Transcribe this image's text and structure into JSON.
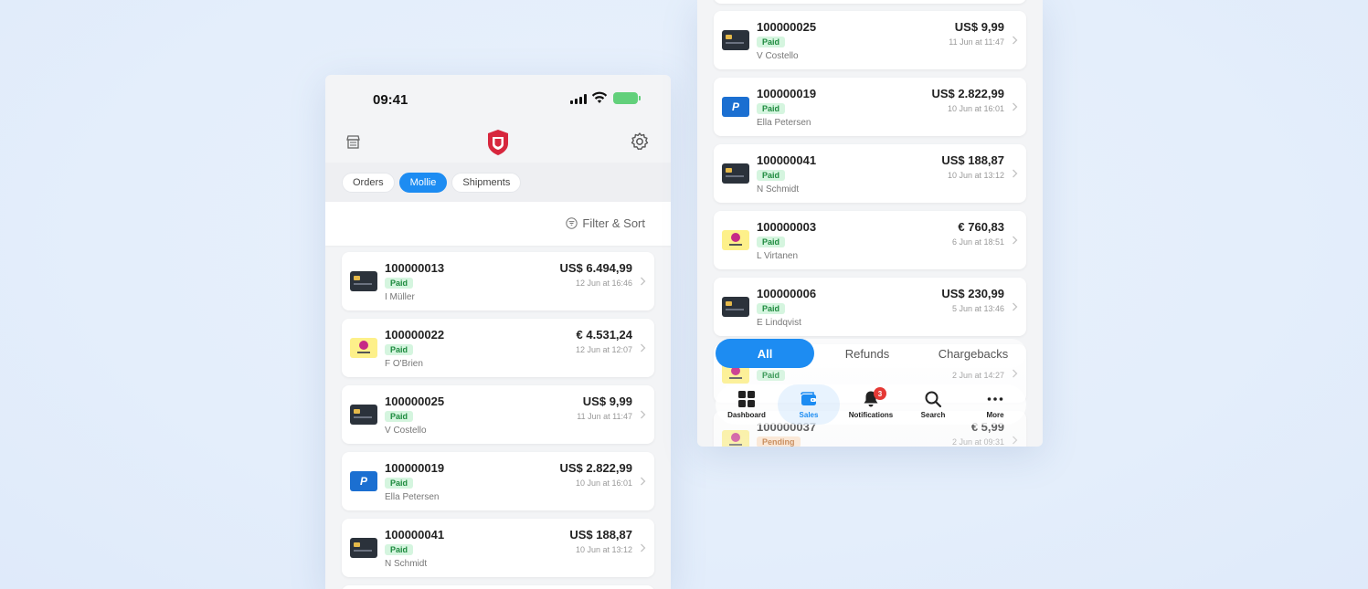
{
  "left_phone": {
    "status_time": "09:41",
    "battery_label": "",
    "segment_tabs": [
      {
        "label": "Orders",
        "active": false
      },
      {
        "label": "Mollie",
        "active": true
      },
      {
        "label": "Shipments",
        "active": false
      }
    ],
    "filter_label": "Filter & Sort",
    "orders": [
      {
        "id": "100000013",
        "status": "Paid",
        "customer": "I Müller",
        "amount": "US$ 6.494,99",
        "date": "12 Jun at 16:46",
        "method": "card"
      },
      {
        "id": "100000022",
        "status": "Paid",
        "customer": "F O'Brien",
        "amount": "€ 4.531,24",
        "date": "12 Jun at 12:07",
        "method": "klarna"
      },
      {
        "id": "100000025",
        "status": "Paid",
        "customer": "V Costello",
        "amount": "US$ 9,99",
        "date": "11 Jun at 11:47",
        "method": "card"
      },
      {
        "id": "100000019",
        "status": "Paid",
        "customer": "Ella Petersen",
        "amount": "US$ 2.822,99",
        "date": "10 Jun at 16:01",
        "method": "paypal"
      },
      {
        "id": "100000041",
        "status": "Paid",
        "customer": "N Schmidt",
        "amount": "US$ 188,87",
        "date": "10 Jun at 13:12",
        "method": "card"
      }
    ]
  },
  "right_phone": {
    "orders": [
      {
        "id": "100000025",
        "status": "Paid",
        "customer": "V Costello",
        "amount": "US$ 9,99",
        "date": "11 Jun at 11:47",
        "method": "card"
      },
      {
        "id": "100000019",
        "status": "Paid",
        "customer": "Ella Petersen",
        "amount": "US$ 2.822,99",
        "date": "10 Jun at 16:01",
        "method": "paypal"
      },
      {
        "id": "100000041",
        "status": "Paid",
        "customer": "N Schmidt",
        "amount": "US$ 188,87",
        "date": "10 Jun at 13:12",
        "method": "card"
      },
      {
        "id": "100000003",
        "status": "Paid",
        "customer": "L Virtanen",
        "amount": "€ 760,83",
        "date": "6 Jun at 18:51",
        "method": "klarna"
      },
      {
        "id": "100000006",
        "status": "Paid",
        "customer": "E Lindqvist",
        "amount": "US$ 230,99",
        "date": "5 Jun at 13:46",
        "method": "card"
      },
      {
        "id": "",
        "status": "Paid",
        "customer": "",
        "amount": "",
        "date": "2 Jun at 14:27",
        "method": "klarna"
      },
      {
        "id": "100000037",
        "status": "Pending",
        "customer": "",
        "amount": "€ 5,99",
        "date": "2 Jun at 09:31",
        "method": "klarna"
      }
    ],
    "filter_pills": [
      {
        "label": "All",
        "active": true
      },
      {
        "label": "Refunds",
        "active": false
      },
      {
        "label": "Chargebacks",
        "active": false
      }
    ],
    "tab_bar": {
      "dashboard": "Dashboard",
      "sales": "Sales",
      "notifications": "Notifications",
      "notifications_count": "3",
      "search": "Search",
      "more": "More"
    }
  },
  "colors": {
    "accent": "#1d8cf2",
    "paid_bg": "#d5f5df",
    "paid_text": "#1d8a3e",
    "pending_bg": "#fde2c8",
    "pending_text": "#b45a12",
    "logo": "#d7263d"
  }
}
